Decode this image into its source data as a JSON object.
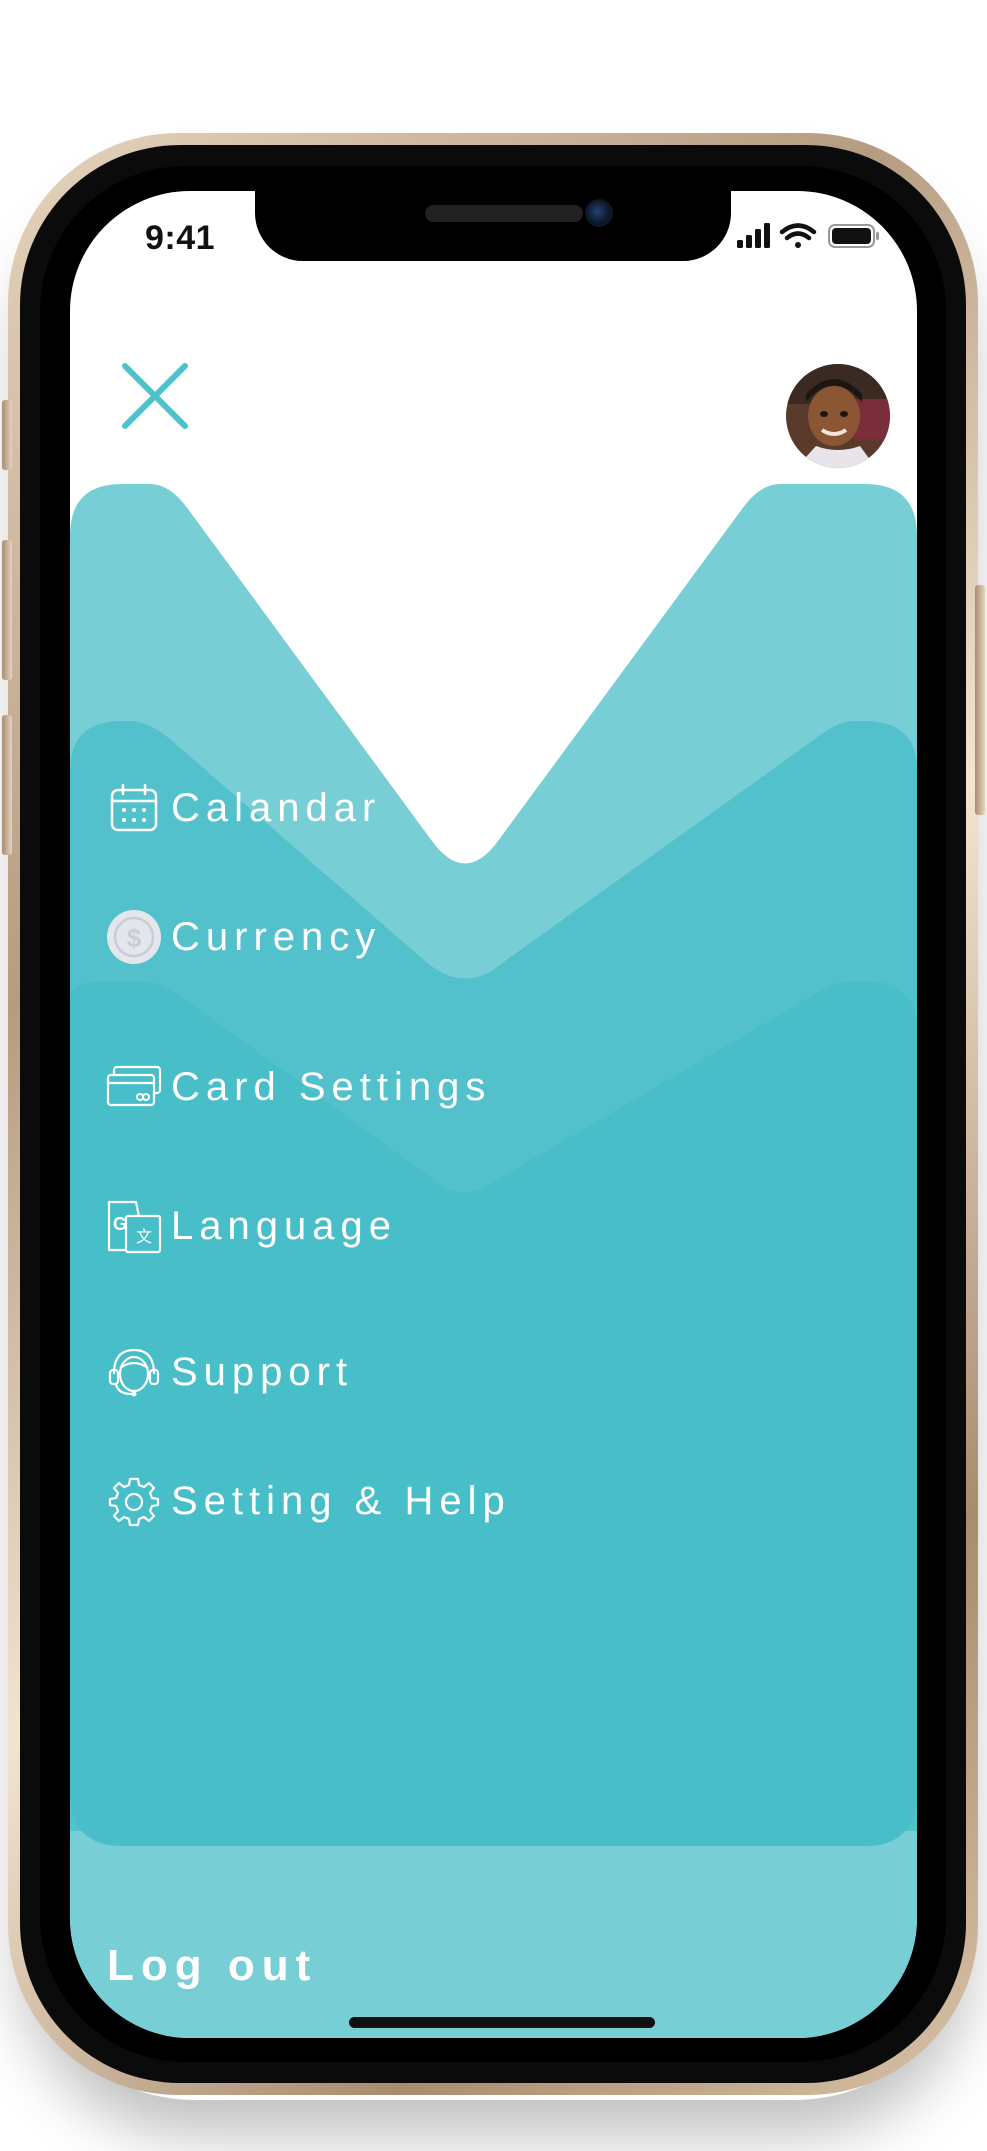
{
  "status_bar": {
    "time": "9:41"
  },
  "menu": {
    "items": [
      {
        "label": "Calandar",
        "icon": "calendar-icon"
      },
      {
        "label": "Currency",
        "icon": "dollar-coin-icon"
      },
      {
        "label": "Card Settings",
        "icon": "credit-card-icon"
      },
      {
        "label": "Language",
        "icon": "translate-icon"
      },
      {
        "label": "Support",
        "icon": "headset-icon"
      },
      {
        "label": "Setting & Help",
        "icon": "gear-icon"
      }
    ]
  },
  "logout_label": "Log out",
  "colors": {
    "wave_light": "#77CFD5",
    "wave_mid": "#52C1CB",
    "wave_dark": "#47BEC8",
    "accent": "#4CC2CB",
    "text": "#FFFFFF"
  }
}
